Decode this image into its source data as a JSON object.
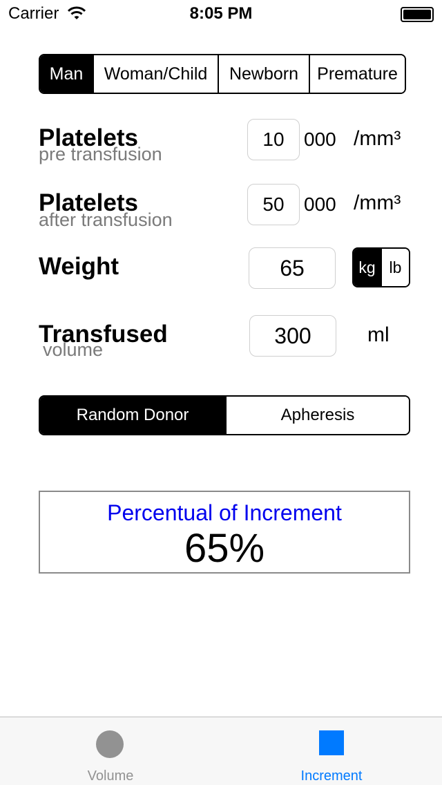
{
  "status_bar": {
    "carrier": "Carrier",
    "time": "8:05 PM",
    "wifi_icon": "wifi-icon",
    "battery_icon": "battery-icon"
  },
  "patient_type": {
    "options": [
      "Man",
      "Woman/Child",
      "Newborn",
      "Premature"
    ],
    "selected": "Man"
  },
  "platelets_pre": {
    "label": "Platelets",
    "sublabel": "pre transfusion",
    "value": "10",
    "suffix": "000",
    "unit": "/mm³"
  },
  "platelets_post": {
    "label": "Platelets",
    "sublabel": "after transfusion",
    "value": "50",
    "suffix": "000",
    "unit": "/mm³"
  },
  "weight": {
    "label": "Weight",
    "value": "65",
    "units": [
      "kg",
      "lb"
    ],
    "selected_unit": "kg"
  },
  "transfused": {
    "label": "Transfused",
    "sublabel": "volume",
    "value": "300",
    "unit": "ml"
  },
  "donor_type": {
    "options": [
      "Random Donor",
      "Apheresis"
    ],
    "selected": "Random Donor"
  },
  "result": {
    "title": "Percentual of Increment",
    "value": "65%"
  },
  "tab_bar": {
    "tabs": [
      {
        "label": "Volume",
        "icon": "circle-icon",
        "active": false
      },
      {
        "label": "Increment",
        "icon": "square-icon",
        "active": true
      }
    ]
  },
  "colors": {
    "accent": "#007aff",
    "inactive_tab": "#929292",
    "result_title": "#0000ee"
  }
}
